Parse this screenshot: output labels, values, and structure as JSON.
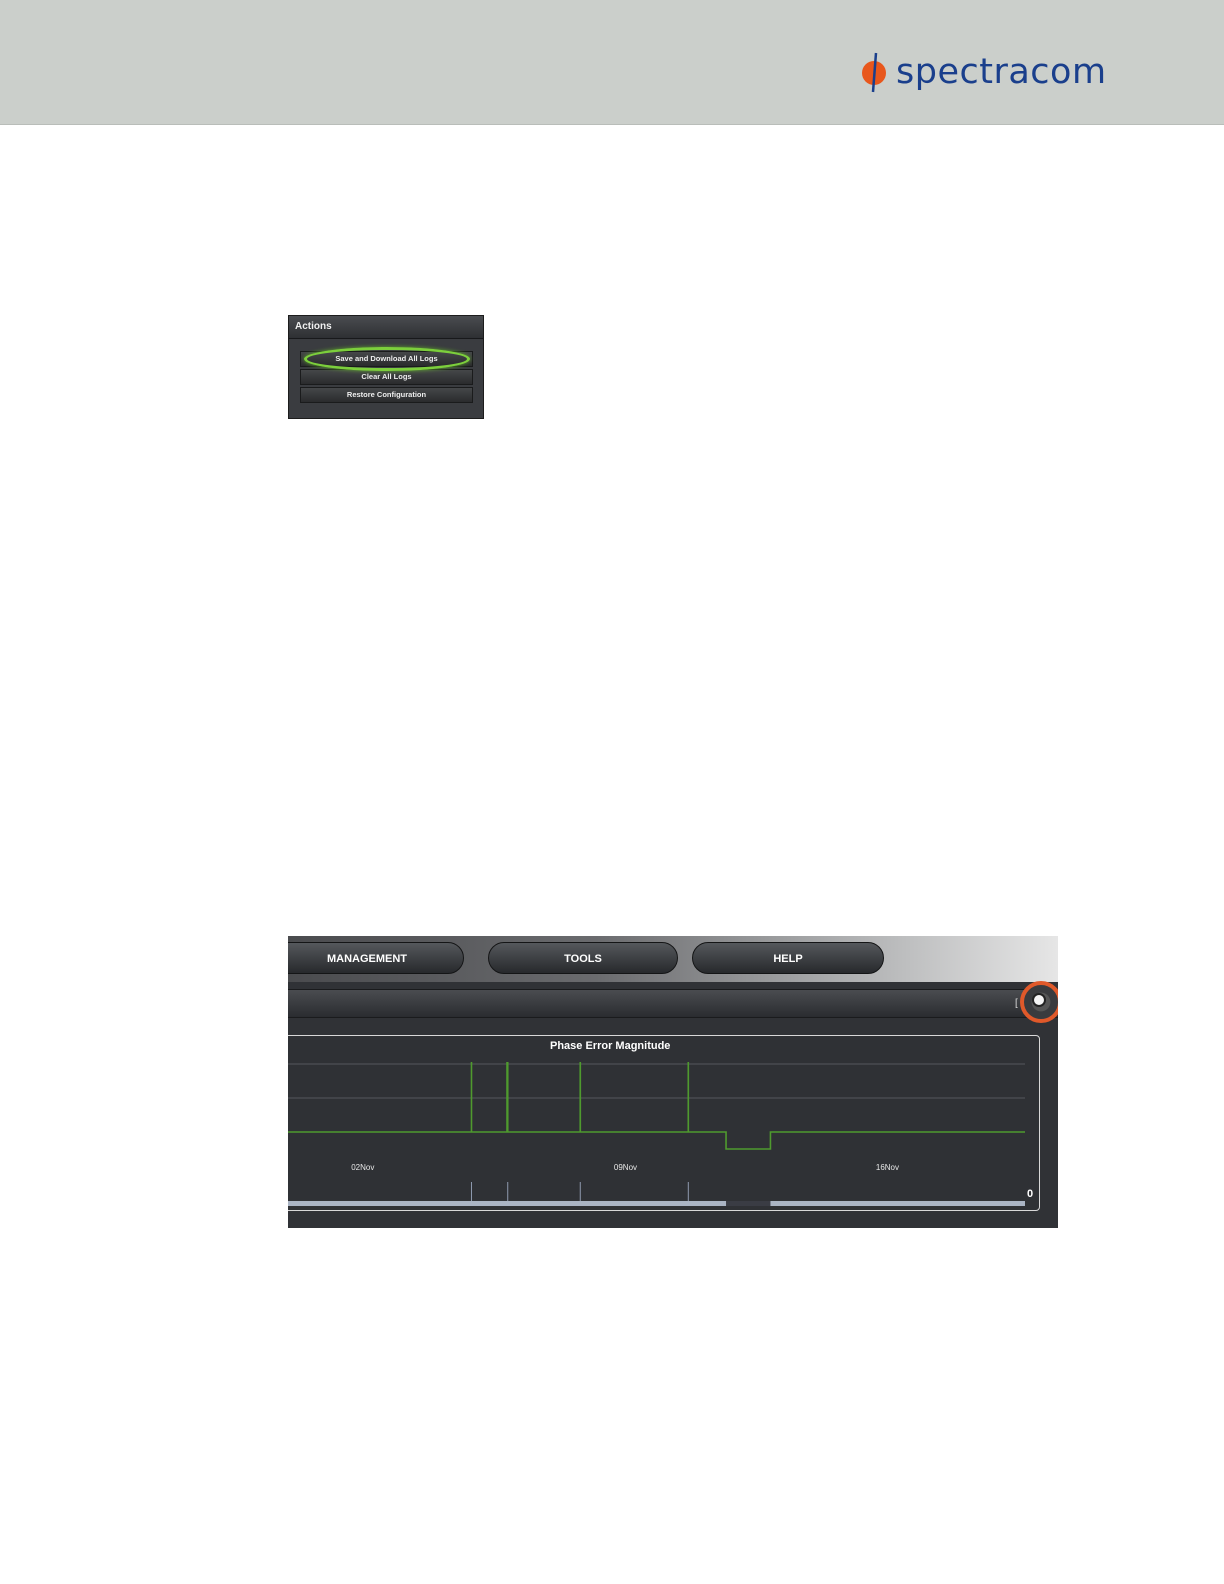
{
  "header": {
    "logo_text": "spectracom",
    "logo_icon": "spectracom-logo-icon"
  },
  "actions_panel": {
    "title": "Actions",
    "buttons": [
      "Save and Download All Logs",
      "Clear All Logs",
      "Restore Configuration"
    ],
    "highlighted": "Save and Download All Logs",
    "highlight_color": "#7ccf3c"
  },
  "nav": {
    "items": [
      "MANAGEMENT",
      "TOOLS",
      "HELP"
    ]
  },
  "icons": {
    "gear": "gear-icon",
    "bracket": "["
  },
  "chart_data": {
    "type": "line",
    "title": "Phase Error Magnitude",
    "x_tick_labels": [
      "02Nov",
      "09Nov",
      "16Nov"
    ],
    "y_tick_labels": [
      "0"
    ],
    "series": [
      {
        "color": "#4f9a2e",
        "spikes": [
          {
            "start": 0.252,
            "end": 0.301
          },
          {
            "start": 0.399,
            "end": 0.545
          }
        ],
        "dip": {
          "start": 0.596,
          "end": 0.656
        }
      }
    ],
    "grid": true
  }
}
